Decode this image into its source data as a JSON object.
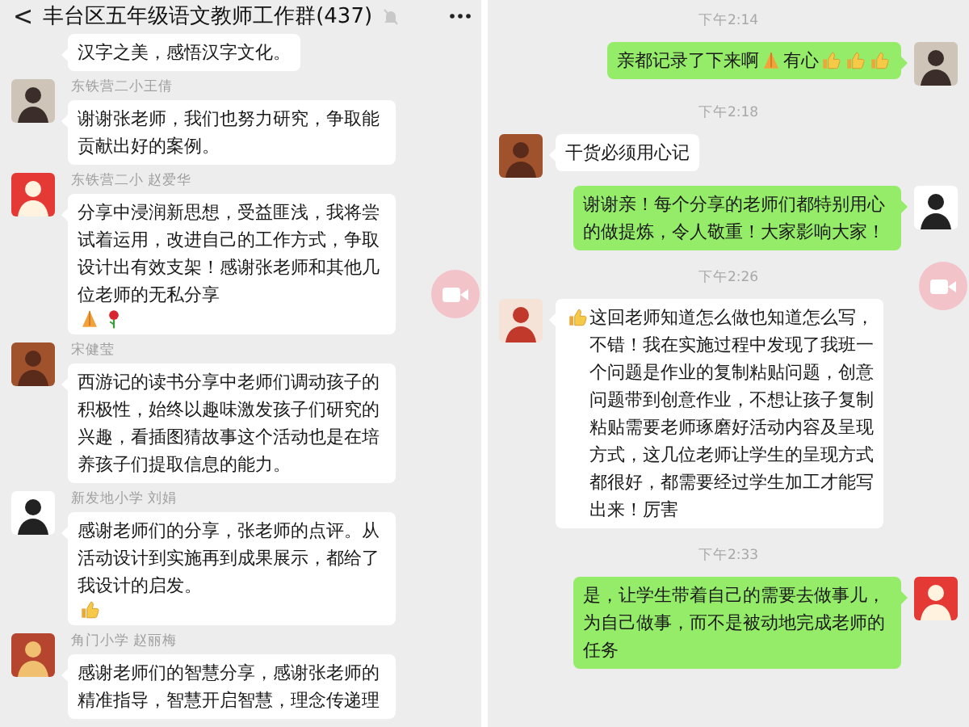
{
  "panes": [
    {
      "header": {
        "back": "<",
        "title": "丰台区五年级语文教师工作群(437)"
      },
      "items": [
        {
          "kind": "incoming",
          "parts": [
            {
              "kind": "text",
              "text": "汉字之美，感悟汉字文化。"
            }
          ]
        },
        {
          "kind": "incoming",
          "sender": "东铁营二小王倩",
          "parts": [
            {
              "kind": "text",
              "text": "谢谢张老师，我们也努力研究，争取能贡献出好的案例。"
            }
          ]
        },
        {
          "kind": "incoming",
          "sender": "东铁营二小 赵爱华",
          "parts": [
            {
              "kind": "text",
              "text": "分享中浸润新思想，受益匪浅，我将尝试着运用，改进自己的工作方式，争取设计出有效支架！感谢张老师和其他几位老师的无私分享"
            },
            {
              "kind": "praying"
            },
            {
              "kind": "rose"
            }
          ]
        },
        {
          "kind": "incoming",
          "sender": "宋健莹",
          "parts": [
            {
              "kind": "text",
              "text": "西游记的读书分享中老师们调动孩子的积极性，始终以趣味激发孩子们研究的兴趣，看插图猜故事这个活动也是在培养孩子们提取信息的能力。"
            }
          ]
        },
        {
          "kind": "incoming",
          "sender": "新发地小学 刘娟",
          "parts": [
            {
              "kind": "text",
              "text": "感谢老师们的分享，张老师的点评。从活动设计到实施再到成果展示，都给了我设计的启发。"
            },
            {
              "kind": "thumbs"
            }
          ]
        },
        {
          "kind": "incoming",
          "sender": "角门小学 赵丽梅",
          "parts": [
            {
              "kind": "text",
              "text": "感谢老师们的智慧分享，感谢张老师的精准指导，智慧开启智慧，理念传递理"
            }
          ]
        }
      ]
    },
    {
      "items": [
        {
          "kind": "time",
          "text": "下午2:14"
        },
        {
          "kind": "outgoing",
          "parts": [
            {
              "kind": "text",
              "text": "亲都记录了下来啊"
            },
            {
              "kind": "praying"
            },
            {
              "kind": "text",
              "text": "有心"
            },
            {
              "kind": "thumbs"
            },
            {
              "kind": "thumbs"
            },
            {
              "kind": "thumbs"
            }
          ]
        },
        {
          "kind": "time",
          "text": "下午2:18"
        },
        {
          "kind": "incoming",
          "parts": [
            {
              "kind": "text",
              "text": "干货必须用心记"
            }
          ]
        },
        {
          "kind": "outgoing",
          "parts": [
            {
              "kind": "text",
              "text": "谢谢亲！每个分享的老师们都特别用心的做提炼，令人敬重！大家影响大家！"
            }
          ]
        },
        {
          "kind": "time",
          "text": "下午2:26"
        },
        {
          "kind": "incoming",
          "parts": [
            {
              "kind": "thumbs"
            },
            {
              "kind": "text",
              "text": "这回老师知道怎么做也知道怎么写，不错！我在实施过程中发现了我班一个问题是作业的复制粘贴问题，创意问题带到创意作业，不想让孩子复制粘贴需要老师琢磨好活动内容及呈现方式，这几位老师让学生的呈现方式都很好，都需要经过学生加工才能写出来！厉害"
            }
          ]
        },
        {
          "kind": "time",
          "text": "下午2:33"
        },
        {
          "kind": "outgoing",
          "parts": [
            {
              "kind": "text",
              "text": "是，让学生带着自己的需要去做事儿，为自己做事，而不是被动地完成老师的任务"
            }
          ]
        }
      ]
    }
  ]
}
